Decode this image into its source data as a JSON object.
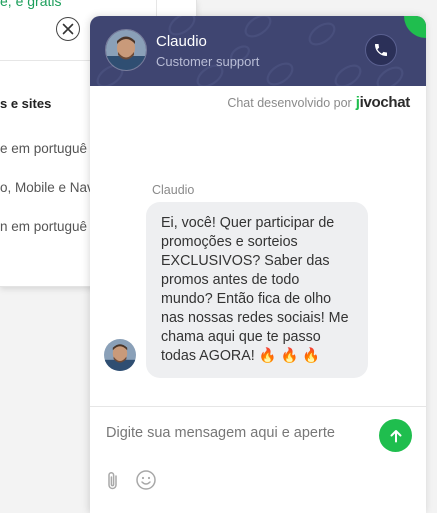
{
  "background_page": {
    "top_partial_text": "e, é grátis",
    "heading": "s e sites",
    "items": [
      {
        "label": "e em portuguê"
      },
      {
        "label": "o, Mobile e Nav"
      },
      {
        "label": "n em portuguê"
      }
    ]
  },
  "chat": {
    "agent": {
      "name": "Claudio",
      "role": "Customer support"
    },
    "powered_by": "Chat desenvolvido por",
    "brand": {
      "prefix": "j",
      "rest": "ivochat"
    },
    "message": {
      "sender": "Claudio",
      "text": "Ei, você! Quer participar de promoções e sorteios EXCLUSIVOS? Saber das promos antes de todo mundo? Então fica de olho nas nossas redes sociais! Me chama aqui que te passo todas AGORA! 🔥 🔥 🔥"
    },
    "composer": {
      "placeholder": "Digite sua mensagem aqui e aperte"
    }
  },
  "colors": {
    "header_bg": "#3f4571",
    "accent_green": "#1fbe4e",
    "bubble_bg": "#eeeff1"
  },
  "icons": [
    "close-icon",
    "phone-icon",
    "send-arrow-icon",
    "paperclip-icon",
    "emoji-icon"
  ]
}
